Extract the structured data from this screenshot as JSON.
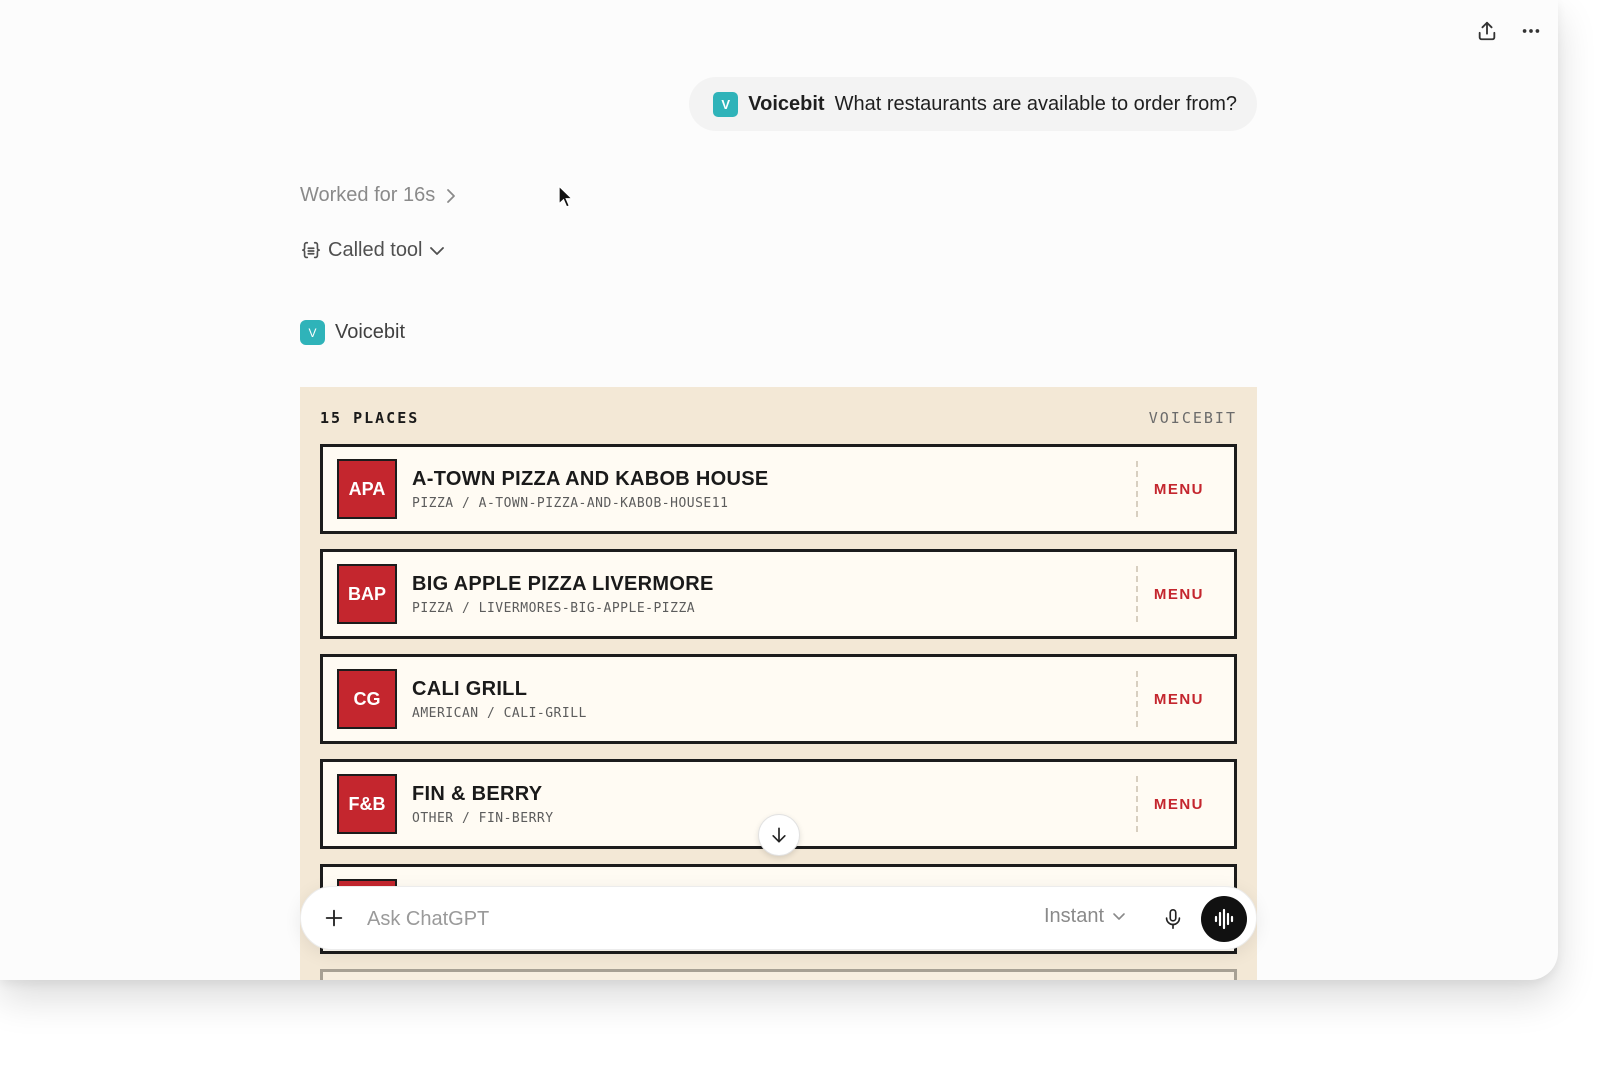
{
  "conversation": {
    "user_message": {
      "app_badge": "V",
      "app_name": "Voicebit",
      "text": "What restaurants are available to order from?"
    },
    "worked_label": "Worked for 16s",
    "tool_label": "Called tool",
    "app_badge": "V",
    "app_name": "Voicebit"
  },
  "widget": {
    "count_label": "15 PLACES",
    "brand_label": "VOICEBIT",
    "menu_label": "MENU",
    "restaurants": [
      {
        "initials": "APA",
        "name": "A-TOWN PIZZA AND KABOB HOUSE",
        "subtitle": "PIZZA / A-TOWN-PIZZA-AND-KABOB-HOUSE11"
      },
      {
        "initials": "BAP",
        "name": "BIG APPLE PIZZA LIVERMORE",
        "subtitle": "PIZZA / LIVERMORES-BIG-APPLE-PIZZA"
      },
      {
        "initials": "CG",
        "name": "CALI GRILL",
        "subtitle": "AMERICAN / CALI-GRILL"
      },
      {
        "initials": "F&B",
        "name": "FIN & BERRY",
        "subtitle": "OTHER / FIN-BERRY"
      }
    ]
  },
  "composer": {
    "placeholder": "Ask ChatGPT",
    "model": "Instant"
  },
  "icons": {
    "share": "share-icon",
    "more": "more-icon",
    "plus": "plus-icon",
    "mic": "mic-icon",
    "voice": "voice-mode-icon",
    "scroll": "arrow-down-icon"
  },
  "colors": {
    "accent_red": "#c4262e",
    "widget_bg": "#f3e8d6",
    "app_teal": "#2fb3b9"
  }
}
